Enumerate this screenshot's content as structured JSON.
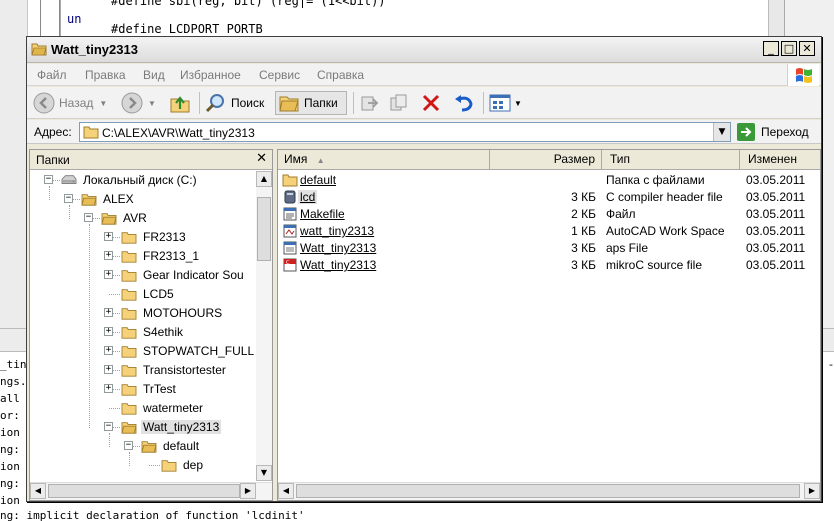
{
  "background": {
    "code_lines": [
      "#define sbi(reg, bit) (reg|= (1<<bit))",
      "#define LCDPORT PORTB"
    ],
    "gutter_fragment": "un",
    "output_fragments": [
      "_tin",
      "ngs.",
      "all",
      "or:",
      "ion",
      "ng:",
      "ion",
      "ng:",
      "ion"
    ],
    "output_bottom_line": "ng: implicit declaration of function 'lcdinit'",
    "right_edge_fragment": "- "
  },
  "window": {
    "title": "Watt_tiny2313",
    "controls": {
      "minimize": "_",
      "maximize": "□",
      "close": "✕"
    },
    "menu": [
      "Файл",
      "Правка",
      "Вид",
      "Избранное",
      "Сервис",
      "Справка"
    ],
    "toolbar": {
      "back_label": "Назад",
      "search_label": "Поиск",
      "folders_label": "Папки"
    },
    "address": {
      "label": "Адрес:",
      "path": "C:\\ALEX\\AVR\\Watt_tiny2313",
      "go_label": "Переход"
    }
  },
  "folder_pane": {
    "title": "Папки",
    "close": "✕",
    "tree": [
      {
        "label": "Локальный диск (C:)",
        "level": 0,
        "expander": "-",
        "icon": "drive-icon"
      },
      {
        "label": "ALEX",
        "level": 1,
        "expander": "-",
        "icon": "folder-open-icon"
      },
      {
        "label": "AVR",
        "level": 2,
        "expander": "-",
        "icon": "folder-open-icon"
      },
      {
        "label": "FR2313",
        "level": 3,
        "expander": "+",
        "icon": "folder-icon"
      },
      {
        "label": "FR2313_1",
        "level": 3,
        "expander": "+",
        "icon": "folder-icon"
      },
      {
        "label": "Gear Indicator Sou",
        "level": 3,
        "expander": "+",
        "icon": "folder-icon"
      },
      {
        "label": "LCD5",
        "level": 3,
        "expander": "",
        "icon": "folder-icon"
      },
      {
        "label": "MOTOHOURS",
        "level": 3,
        "expander": "+",
        "icon": "folder-icon"
      },
      {
        "label": "S4ethik",
        "level": 3,
        "expander": "+",
        "icon": "folder-icon"
      },
      {
        "label": "STOPWATCH_FULL",
        "level": 3,
        "expander": "+",
        "icon": "folder-icon"
      },
      {
        "label": "Transistortester",
        "level": 3,
        "expander": "+",
        "icon": "folder-icon"
      },
      {
        "label": "TrTest",
        "level": 3,
        "expander": "+",
        "icon": "folder-icon"
      },
      {
        "label": "watermeter",
        "level": 3,
        "expander": "",
        "icon": "folder-icon"
      },
      {
        "label": "Watt_tiny2313",
        "level": 3,
        "expander": "-",
        "icon": "folder-open-icon",
        "selected": true
      },
      {
        "label": "default",
        "level": 4,
        "expander": "-",
        "icon": "folder-open-icon"
      },
      {
        "label": "dep",
        "level": 5,
        "expander": "",
        "icon": "folder-icon"
      }
    ]
  },
  "file_list": {
    "columns": [
      "Имя",
      "Размер",
      "Тип",
      "Изменен"
    ],
    "rows": [
      {
        "name": "default",
        "size": "",
        "type": "Папка с файлами",
        "modified": "03.05.2011",
        "icon": "folder-icon"
      },
      {
        "name": "lcd",
        "size": "3 КБ",
        "type": "C compiler header file",
        "modified": "03.05.2011",
        "icon": "header-file-icon",
        "selected": true
      },
      {
        "name": "Makefile",
        "size": "2 КБ",
        "type": "Файл",
        "modified": "03.05.2011",
        "icon": "generic-file-icon"
      },
      {
        "name": "watt_tiny2313",
        "size": "1 КБ",
        "type": "AutoCAD Work Space",
        "modified": "03.05.2011",
        "icon": "autocad-file-icon"
      },
      {
        "name": "Watt_tiny2313",
        "size": "3 КБ",
        "type": "aps File",
        "modified": "03.05.2011",
        "icon": "aps-file-icon"
      },
      {
        "name": "Watt_tiny2313",
        "size": "3 КБ",
        "type": "mikroC source file",
        "modified": "03.05.2011",
        "icon": "mikroc-file-icon"
      }
    ]
  },
  "colors": {
    "accent_green": "#3a9a3a",
    "folder_yellow": "#f5d27a",
    "delete_red": "#d01818",
    "undo_blue": "#1a5cc8"
  }
}
